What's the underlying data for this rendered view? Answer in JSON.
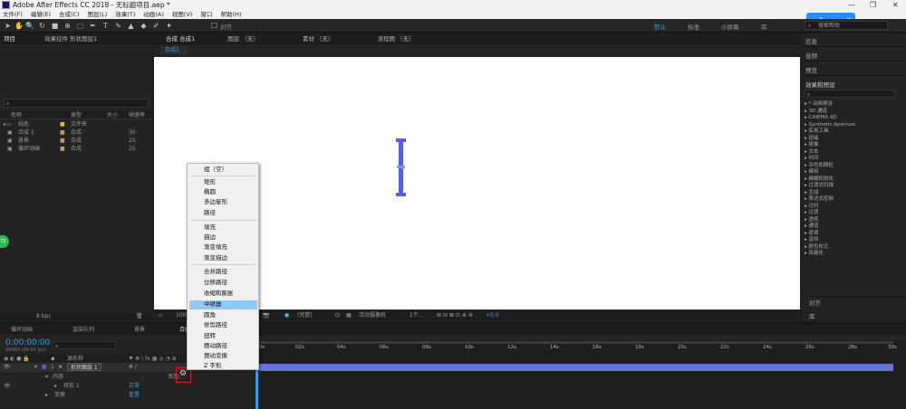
{
  "window": {
    "title": "Adobe After Effects CC 2018 - 无标题项目.aep *",
    "controls": [
      "—",
      "❐",
      "✕"
    ]
  },
  "menu": [
    "文件(F)",
    "编辑(E)",
    "合成(C)",
    "图层(L)",
    "效果(T)",
    "动画(A)",
    "视图(V)",
    "窗口",
    "帮助(H)"
  ],
  "toolbar": {
    "align_label": "对齐",
    "workspaces": [
      "默认",
      "标准",
      "小屏幕",
      "库"
    ],
    "search_help": "搜索帮助",
    "overlay": "6",
    "overlay_close": "✕"
  },
  "project_panel": {
    "tabs": [
      "项目",
      "效果控件 形状图层1"
    ],
    "columns": [
      "名称",
      "类型",
      "大小",
      "帧速率"
    ],
    "items": [
      {
        "name": "纯色",
        "type": "文件夹",
        "size": ""
      },
      {
        "name": "合成 1",
        "type": "合成",
        "size": "30"
      },
      {
        "name": "背景",
        "type": "合成",
        "size": "25"
      },
      {
        "name": "循环动画",
        "type": "合成",
        "size": "25"
      }
    ],
    "footer_bpc": "8 bpc"
  },
  "comp_panel": {
    "tab_main": "合成 合成1",
    "tabs": [
      "图层 （无）",
      "素材 （无）",
      "流程图 （无）"
    ],
    "breadcrumb": "合成1",
    "bottom_zoom": "100%",
    "bottom_quality": "(完整)",
    "bottom_camera": "活动摄像机",
    "bottom_view": "1个...",
    "bottom_exposure": "+0.0"
  },
  "context_menu": {
    "items": [
      "组（空）",
      "矩形",
      "椭圆",
      "多边星形",
      "路径",
      "填充",
      "描边",
      "渐变填充",
      "渐变描边",
      "合并路径",
      "位移路径",
      "收缩和膨胀",
      "中继器",
      "圆角",
      "修剪路径",
      "扭转",
      "摆动路径",
      "摆动变换",
      "Z 字形"
    ],
    "highlighted": "中继器"
  },
  "right_panel": {
    "sections": [
      "信息",
      "音频",
      "预览"
    ],
    "effects_title": "效果和预设",
    "effects": [
      "* 动画预设",
      "3D 通道",
      "CINEMA 4D",
      "Synthetic Aperture",
      "实用工具",
      "扭曲",
      "抠像",
      "文本",
      "时间",
      "杂色和颗粒",
      "模拟",
      "模糊和锐化",
      "过渡式扫描",
      "生成",
      "表达式控制",
      "过时",
      "过渡",
      "透视",
      "通道",
      "遮罩",
      "音频",
      "颜色校正",
      "风格化"
    ],
    "bottom_sections": [
      "对齐",
      "库"
    ]
  },
  "timeline": {
    "tabs": [
      "循环动画",
      "渲染队列",
      "背景",
      "合成1"
    ],
    "timecode": "0:00:00:00",
    "fps_note": "00000 (30.00 fps)",
    "columns": [
      "源名称",
      "父级"
    ],
    "layer_num": "1",
    "layer_name": "形状图层 1",
    "parent_value": "无",
    "sub_content": "内容",
    "sub_rect": "矩形 1",
    "sub_transform": "变换",
    "blend_mode": "正常",
    "reset_label": "重置",
    "add_label": "添加:",
    "ruler": [
      "0s",
      "02s",
      "04s",
      "06s",
      "08s",
      "10s",
      "12s",
      "14s",
      "16s",
      "18s",
      "20s",
      "22s",
      "24s",
      "26s",
      "28s",
      "30s"
    ]
  },
  "colors": {
    "accent": "#3a9be0",
    "shape_blue": "#5560d8",
    "track_blue": "#6673d6",
    "highlight": "#91c9f7",
    "annot_red": "#e02020"
  }
}
